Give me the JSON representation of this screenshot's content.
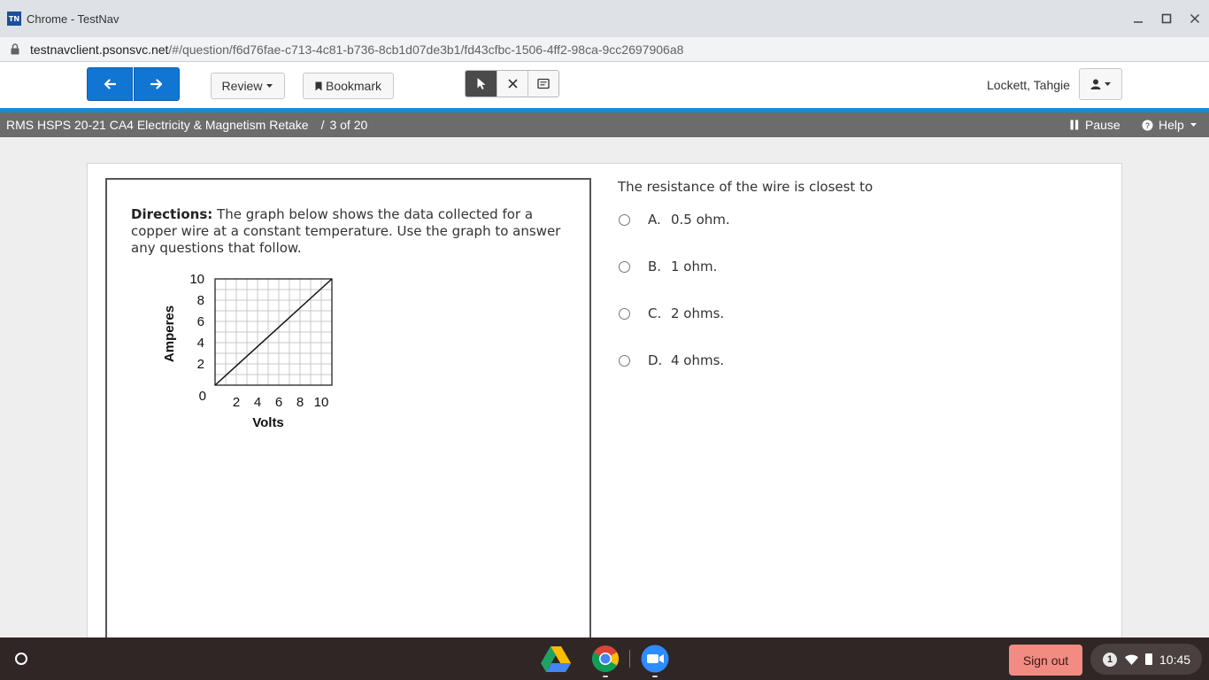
{
  "window": {
    "title": "Chrome - TestNav",
    "logo_text": "TN"
  },
  "address": {
    "host": "testnavclient.psonsvc.net",
    "path": "/#/question/f6d76fae-c713-4c81-b736-8cb1d07de3b1/fd43cfbc-1506-4ff2-98ca-9cc2697906a8"
  },
  "toolbar": {
    "review_label": "Review",
    "bookmark_label": "Bookmark",
    "user_name": "Lockett, Tahgie",
    "accent_color": "#1175d3"
  },
  "test": {
    "name": "RMS HSPS 20-21 CA4 Electricity & Magnetism Retake",
    "separator": "/",
    "progress": "3 of 20",
    "pause_label": "Pause",
    "help_label": "Help"
  },
  "passage": {
    "directions_label": "Directions:",
    "directions_text": " The graph below shows the data collected for a copper wire at a constant temperature. Use the graph to answer any questions that follow."
  },
  "chart_data": {
    "type": "line",
    "title": "",
    "xlabel": "Volts",
    "ylabel": "Amperes",
    "xlim": [
      0,
      11
    ],
    "ylim": [
      0,
      10
    ],
    "xticks": [
      2,
      4,
      6,
      8,
      10
    ],
    "yticks": [
      2,
      4,
      6,
      8,
      10
    ],
    "origin_label": "0",
    "grid": true,
    "series": [
      {
        "x": [
          0,
          11
        ],
        "y": [
          0,
          10
        ]
      }
    ]
  },
  "question": {
    "prompt": "The resistance of the wire is closest to",
    "choices": [
      {
        "letter": "A.",
        "text": "0.5 ohm."
      },
      {
        "letter": "B.",
        "text": "1 ohm."
      },
      {
        "letter": "C.",
        "text": "2 ohms."
      },
      {
        "letter": "D.",
        "text": "4 ohms."
      }
    ]
  },
  "shelf": {
    "signout_label": "Sign out",
    "notification_count": "1",
    "clock": "10:45"
  }
}
